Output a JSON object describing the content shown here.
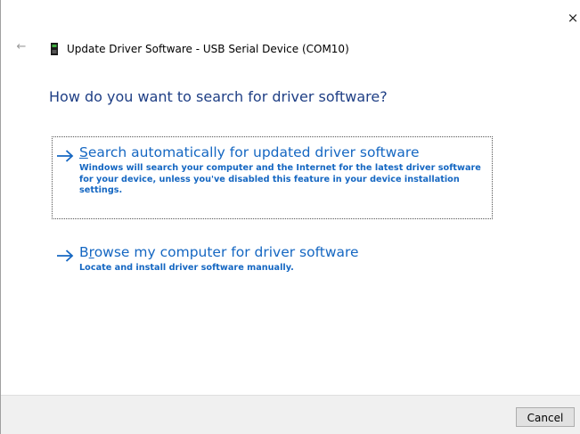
{
  "window": {
    "title": "Update Driver Software - USB Serial Device (COM10)",
    "close_glyph": "×",
    "back_glyph": "←",
    "device_icon": "usb-device-icon"
  },
  "main": {
    "heading": "How do you want to search for driver software?",
    "options": [
      {
        "icon": "arrow-right-icon",
        "access_key": "S",
        "title_rest": "earch automatically for updated driver software",
        "description": "Windows will search your computer and the Internet for the latest driver software for your device, unless you've disabled this feature in your device installation settings.",
        "focused": true
      },
      {
        "icon": "arrow-right-icon",
        "access_key_prefix": "B",
        "access_key": "r",
        "title_rest": "owse my computer for driver software",
        "description": "Locate and install driver software manually.",
        "focused": false
      }
    ]
  },
  "footer": {
    "cancel_label": "Cancel"
  },
  "colors": {
    "heading": "#1f3f85",
    "link": "#1567c2",
    "footer_bg": "#f0f0f0"
  }
}
